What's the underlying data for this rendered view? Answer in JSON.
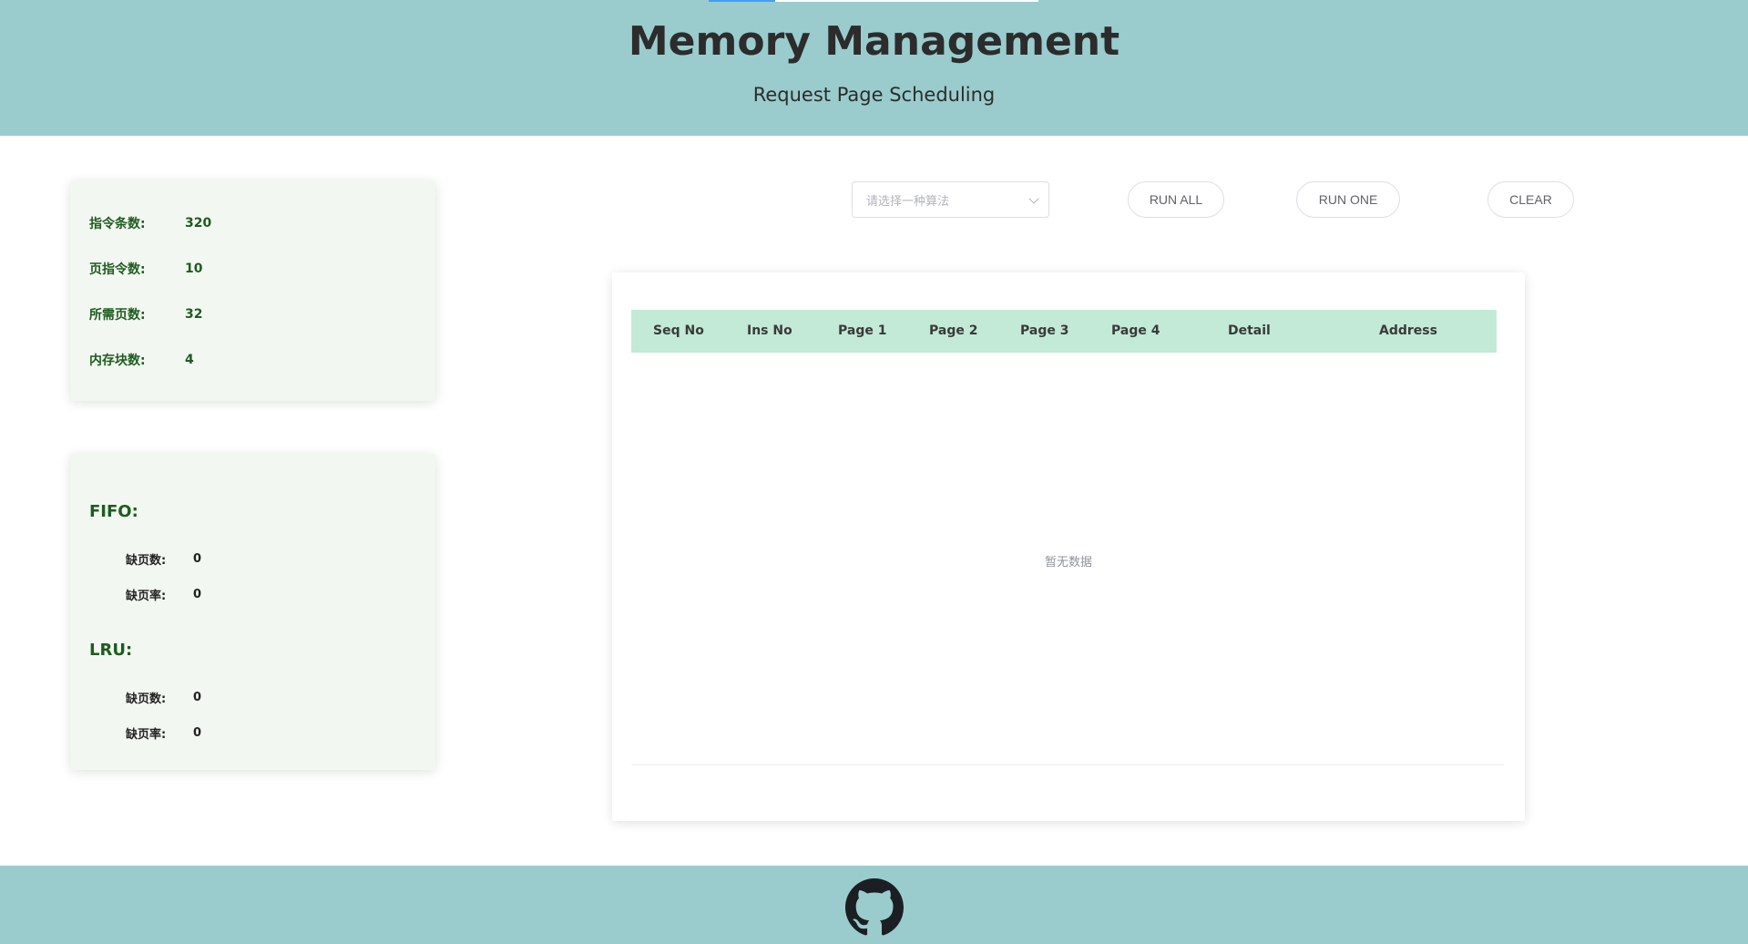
{
  "header": {
    "title": "Memory Management",
    "subtitle": "Request Page Scheduling"
  },
  "info": {
    "rows": [
      {
        "label": "指令条数:",
        "value": "320"
      },
      {
        "label": "页指令数:",
        "value": "10"
      },
      {
        "label": "所需页数:",
        "value": "32"
      },
      {
        "label": "内存块数:",
        "value": "4"
      }
    ]
  },
  "stats": {
    "fifo": {
      "title": "FIFO:",
      "faults_label": "缺页数:",
      "faults": "0",
      "rate_label": "缺页率:",
      "rate": "0"
    },
    "lru": {
      "title": "LRU:",
      "faults_label": "缺页数:",
      "faults": "0",
      "rate_label": "缺页率:",
      "rate": "0"
    }
  },
  "controls": {
    "select_placeholder": "请选择一种算法",
    "run_all": "RUN ALL",
    "run_one": "RUN ONE",
    "clear": "CLEAR"
  },
  "table": {
    "columns": [
      "Seq No",
      "Ins No",
      "Page 1",
      "Page 2",
      "Page 3",
      "Page 4",
      "Detail",
      "Address"
    ],
    "empty_text": "暂无数据"
  },
  "footer": {
    "icon": "github-icon"
  }
}
